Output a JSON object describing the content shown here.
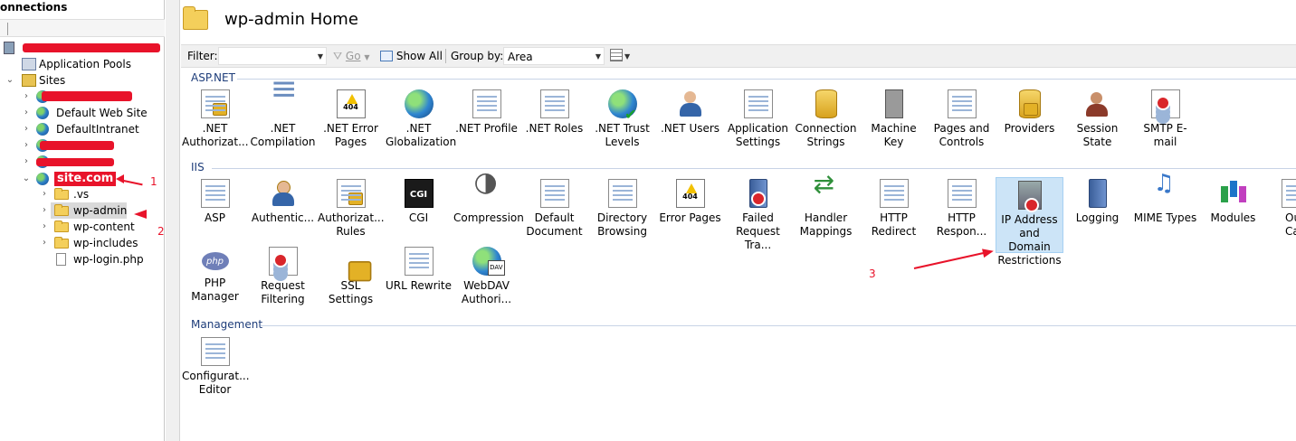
{
  "connections": {
    "title": "onnections",
    "tree": [
      {
        "label": "Application Pools"
      },
      {
        "label": "Sites"
      },
      {
        "label": "Default Web Site"
      },
      {
        "label": "DefaultIntranet"
      },
      {
        "label": "site.com"
      },
      {
        "label": ".vs"
      },
      {
        "label": "wp-admin"
      },
      {
        "label": "wp-content"
      },
      {
        "label": "wp-includes"
      },
      {
        "label": "wp-login.php"
      }
    ]
  },
  "main": {
    "title": "wp-admin Home",
    "filterbar": {
      "filter_label": "Filter:",
      "go_label": "Go",
      "show_all_label": "Show All",
      "group_by_label": "Group by:",
      "group_by_value": "Area"
    },
    "groups": [
      {
        "name": "ASP.NET",
        "features": [
          {
            "label": ".NET Authorizat...",
            "icon": "lock-doc-icon"
          },
          {
            "label": ".NET Compilation",
            "icon": "compilation-icon"
          },
          {
            "label": ".NET Error Pages",
            "icon": "error-404-icon"
          },
          {
            "label": ".NET Globalization",
            "icon": "globe-icon"
          },
          {
            "label": ".NET Profile",
            "icon": "profile-icon"
          },
          {
            "label": ".NET Roles",
            "icon": "roles-icon"
          },
          {
            "label": ".NET Trust Levels",
            "icon": "trust-globe-icon"
          },
          {
            "label": ".NET Users",
            "icon": "users-icon"
          },
          {
            "label": "Application Settings",
            "icon": "settings-doc-icon"
          },
          {
            "label": "Connection Strings",
            "icon": "database-icon"
          },
          {
            "label": "Machine Key",
            "icon": "machine-key-icon"
          },
          {
            "label": "Pages and Controls",
            "icon": "pages-controls-icon"
          },
          {
            "label": "Providers",
            "icon": "providers-icon"
          },
          {
            "label": "Session State",
            "icon": "session-state-icon"
          },
          {
            "label": "SMTP E-mail",
            "icon": "smtp-email-icon"
          }
        ]
      },
      {
        "name": "IIS",
        "features": [
          {
            "label": "ASP",
            "icon": "asp-icon"
          },
          {
            "label": "Authentic...",
            "icon": "authentication-icon"
          },
          {
            "label": "Authorizat... Rules",
            "icon": "authorization-rules-icon"
          },
          {
            "label": "CGI",
            "icon": "cgi-icon"
          },
          {
            "label": "Compression",
            "icon": "compression-icon"
          },
          {
            "label": "Default Document",
            "icon": "default-document-icon"
          },
          {
            "label": "Directory Browsing",
            "icon": "directory-browsing-icon"
          },
          {
            "label": "Error Pages",
            "icon": "error-pages-icon"
          },
          {
            "label": "Failed Request Tra...",
            "icon": "failed-request-icon"
          },
          {
            "label": "Handler Mappings",
            "icon": "handler-mappings-icon"
          },
          {
            "label": "HTTP Redirect",
            "icon": "http-redirect-icon"
          },
          {
            "label": "HTTP Respon...",
            "icon": "http-response-icon"
          },
          {
            "label": "IP Address and Domain Restrictions",
            "icon": "ip-restrictions-icon"
          },
          {
            "label": "Logging",
            "icon": "logging-icon"
          },
          {
            "label": "MIME Types",
            "icon": "mime-types-icon"
          },
          {
            "label": "Modules",
            "icon": "modules-icon"
          },
          {
            "label": "Ou Cac",
            "icon": "output-caching-icon"
          },
          {
            "label": "PHP Manager",
            "icon": "php-icon"
          },
          {
            "label": "Request Filtering",
            "icon": "request-filtering-icon"
          },
          {
            "label": "SSL Settings",
            "icon": "ssl-lock-icon"
          },
          {
            "label": "URL Rewrite",
            "icon": "url-rewrite-icon"
          },
          {
            "label": "WebDAV Authori...",
            "icon": "webdav-icon"
          }
        ]
      },
      {
        "name": "Management",
        "features": [
          {
            "label": "Configurat... Editor",
            "icon": "configuration-editor-icon"
          }
        ]
      }
    ]
  },
  "annotations": [
    "1",
    "2",
    "3"
  ],
  "colors": {
    "annotation": "#e8132a",
    "selected": "#cce4f7",
    "group_header": "#1e3d7a"
  }
}
